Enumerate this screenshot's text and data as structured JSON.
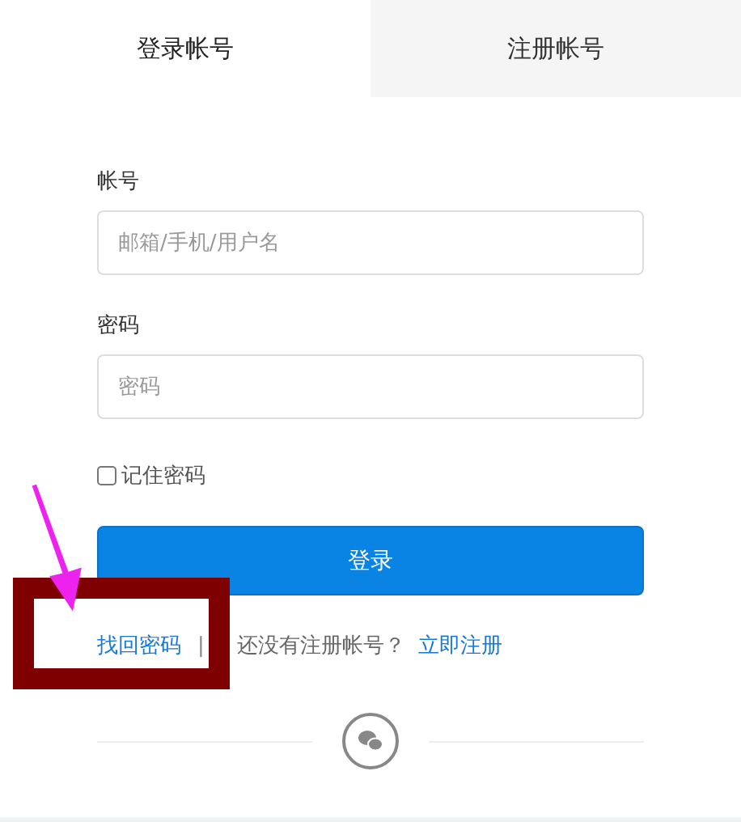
{
  "tabs": [
    {
      "label": "登录帐号",
      "selected": true
    },
    {
      "label": "注册帐号",
      "selected": false
    }
  ],
  "fields": [
    {
      "label": "帐号",
      "placeholder": "邮箱/手机/用户名"
    },
    {
      "label": "密码",
      "placeholder": "密码"
    }
  ],
  "remember": {
    "label": "记住密码",
    "checked": false
  },
  "submit": {
    "label": "登录"
  },
  "links": {
    "forgot": "找回密码",
    "separator": "|",
    "prompt": "还没有注册帐号？",
    "register": "立即注册"
  }
}
